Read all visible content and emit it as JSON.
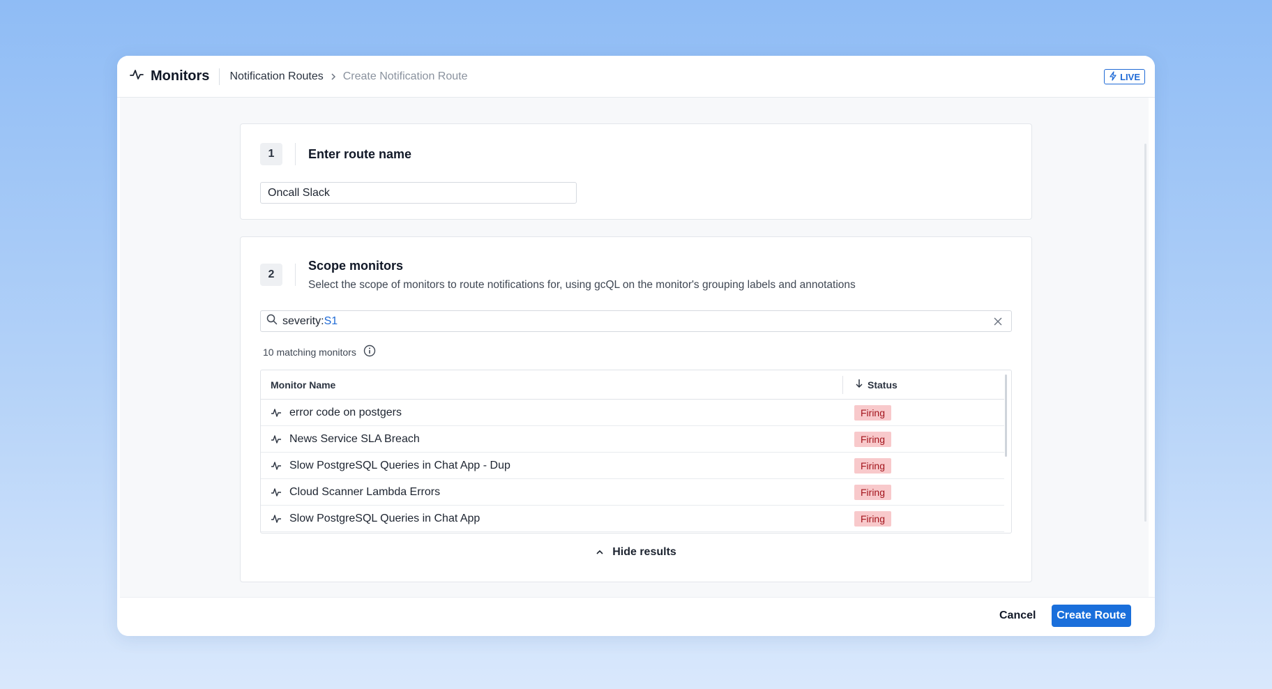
{
  "header": {
    "app_title": "Monitors",
    "breadcrumb": [
      "Notification Routes",
      "Create Notification Route"
    ],
    "live_label": "LIVE"
  },
  "step1": {
    "number": "1",
    "title": "Enter route name",
    "route_name_value": "Oncall Slack"
  },
  "step2": {
    "number": "2",
    "title": "Scope monitors",
    "description": "Select the scope of monitors to route notifications for, using gcQL on the monitor's grouping labels and annotations",
    "search_key": "severity:",
    "search_value": "S1",
    "match_count_text": "10 matching monitors",
    "table": {
      "col_name": "Monitor Name",
      "col_status": "Status",
      "rows": [
        {
          "name": "error code on postgers",
          "status": "Firing"
        },
        {
          "name": "News Service SLA Breach",
          "status": "Firing"
        },
        {
          "name": "Slow PostgreSQL Queries in Chat App - Dup",
          "status": "Firing"
        },
        {
          "name": "Cloud Scanner Lambda Errors",
          "status": "Firing"
        },
        {
          "name": "Slow PostgreSQL Queries in Chat App",
          "status": "Firing"
        }
      ]
    },
    "hide_results_label": "Hide results"
  },
  "footer": {
    "cancel_label": "Cancel",
    "create_label": "Create Route"
  },
  "colors": {
    "accent": "#1a6fdb",
    "firing_bg": "#f8c9cb",
    "firing_text": "#a3151d"
  },
  "icons": [
    "monitor-pulse-icon",
    "chevron-right-icon",
    "lightning-icon",
    "search-icon",
    "close-icon",
    "info-icon",
    "arrow-down-icon",
    "chevron-up-icon"
  ]
}
